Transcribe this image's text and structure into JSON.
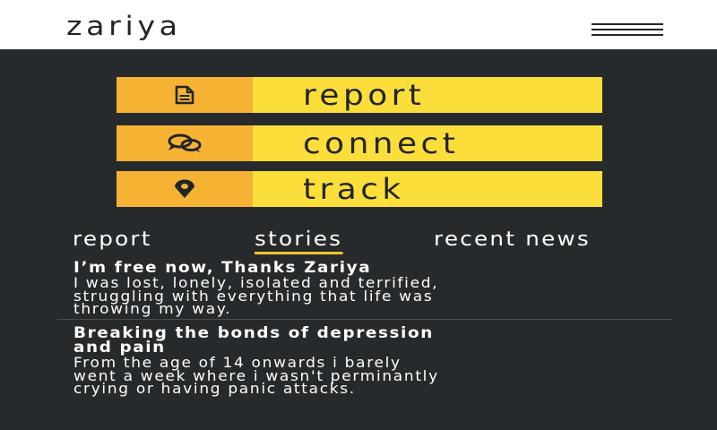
{
  "header": {
    "logo": "zariya",
    "menu_icon": "hamburger-menu-icon"
  },
  "actions": [
    {
      "label": "report",
      "icon": "document-icon"
    },
    {
      "label": "connect",
      "icon": "chat-bubbles-icon"
    },
    {
      "label": "track",
      "icon": "location-pin-icon"
    }
  ],
  "tabs": [
    {
      "label": "report",
      "active": false
    },
    {
      "label": "stories",
      "active": true
    },
    {
      "label": "recent news",
      "active": false
    }
  ],
  "stories": [
    {
      "title": "I’m free now, Thanks Zariya",
      "lines": [
        "I was lost, lonely, isolated and terrified,",
        "struggling with everything that life was",
        "throwing my way."
      ]
    },
    {
      "title_lines": [
        "Breaking the bonds of depression",
        "and pain"
      ],
      "lines": [
        "From the age of 14 onwards i barely",
        "went a week where i wasn't perminantly",
        "crying or having panic attacks."
      ]
    }
  ],
  "colors": {
    "background_dark": "#272a2c",
    "accent_orange": "#f6b232",
    "accent_yellow": "#fbde3a",
    "tab_underline": "#f6c431"
  }
}
